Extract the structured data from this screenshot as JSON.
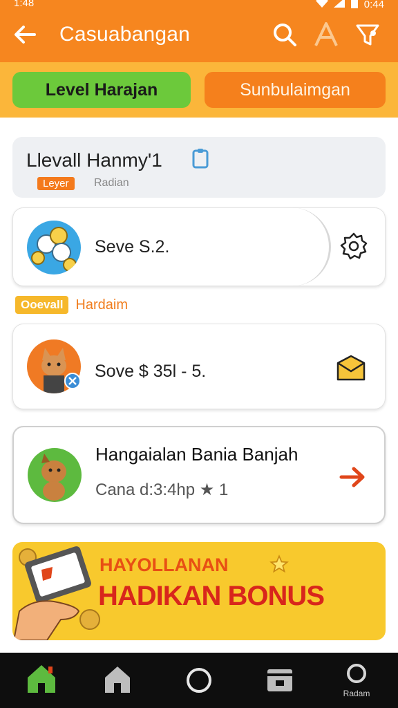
{
  "status_bar": {
    "time": "1:48",
    "battery_text": "0:44"
  },
  "header": {
    "title": "Casuabangan"
  },
  "tabs": [
    {
      "label": "Level Harajan",
      "active": true
    },
    {
      "label": "Sunbulaimgan",
      "active": false
    }
  ],
  "summary": {
    "name": "Llevall Hanmy'1",
    "badge": "Leyer",
    "subtitle": "Radian"
  },
  "items": [
    {
      "text": "Seve S.2.",
      "icon": "gear-icon"
    },
    {
      "text": "Sove $ 35l - 5.",
      "icon": "envelope-icon"
    }
  ],
  "section": {
    "tag": "Ooevall",
    "label": "Hardaim"
  },
  "featured": {
    "title": "Hangaialan Bania Banjah",
    "subtitle": "Cana d:3:4hp ★ 1"
  },
  "banner": {
    "line1": "HAYOLLANAN",
    "line2": "HADIKAN BONUS"
  },
  "bottom_nav": {
    "profile_label": "Radam"
  },
  "colors": {
    "primary": "#f6861f",
    "accent": "#6cc93b",
    "banner": "#f8c92d"
  }
}
